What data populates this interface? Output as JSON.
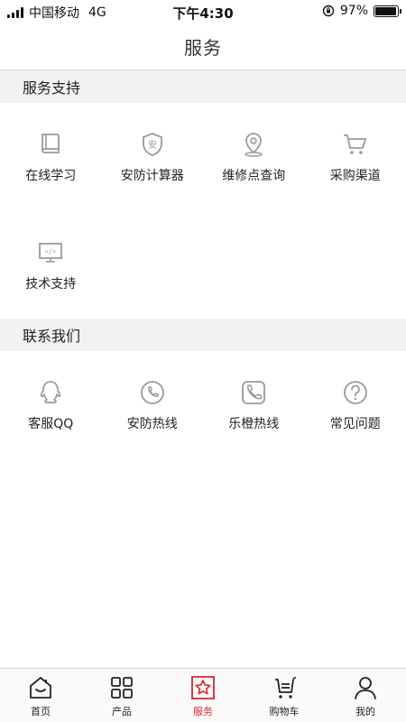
{
  "status_bar": {
    "carrier": "中国移动",
    "network": "4G",
    "time": "下午4:30",
    "battery": "97%",
    "battery_level": 0.97
  },
  "nav": {
    "title": "服务"
  },
  "sections": [
    {
      "title": "服务支持",
      "items": [
        {
          "label": "在线学习",
          "icon": "book-icon"
        },
        {
          "label": "安防计算器",
          "icon": "shield-icon"
        },
        {
          "label": "维修点查询",
          "icon": "location-pin-icon"
        },
        {
          "label": "采购渠道",
          "icon": "shopping-cart-icon"
        },
        {
          "label": "技术支持",
          "icon": "code-monitor-icon"
        }
      ]
    },
    {
      "title": "联系我们",
      "items": [
        {
          "label": "客服QQ",
          "icon": "qq-icon"
        },
        {
          "label": "安防热线",
          "icon": "phone-circle-icon"
        },
        {
          "label": "乐橙热线",
          "icon": "phone-square-icon"
        },
        {
          "label": "常见问题",
          "icon": "question-circle-icon"
        }
      ]
    }
  ],
  "tabs": [
    {
      "label": "首页",
      "icon": "home-icon",
      "active": false
    },
    {
      "label": "产品",
      "icon": "grid-icon",
      "active": false
    },
    {
      "label": "服务",
      "icon": "star-badge-icon",
      "active": true
    },
    {
      "label": "购物车",
      "icon": "cart-icon",
      "active": false
    },
    {
      "label": "我的",
      "icon": "person-icon",
      "active": false
    }
  ],
  "colors": {
    "accent": "#d9262c",
    "icon_gray": "#9a9a9a",
    "section_bg": "#f2f2f2"
  }
}
